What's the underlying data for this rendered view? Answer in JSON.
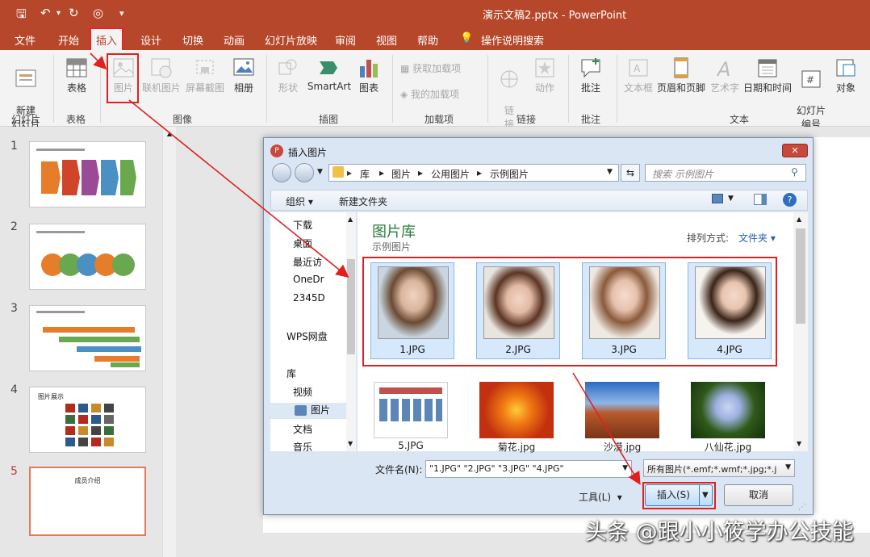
{
  "window": {
    "title": "演示文稿2.pptx - PowerPoint"
  },
  "menu_tabs": [
    "文件",
    "开始",
    "插入",
    "设计",
    "切换",
    "动画",
    "幻灯片放映",
    "审阅",
    "视图",
    "帮助"
  ],
  "tell_me": "操作说明搜索",
  "ribbon": {
    "new_slide": "新建\n幻灯片",
    "table": "表格",
    "picture": "图片",
    "online_picture": "联机图片",
    "screenshot": "屏幕截图",
    "album": "相册",
    "shapes": "形状",
    "smartart": "SmartArt",
    "chart": "图表",
    "get_addins": "获取加载项",
    "my_addins": "我的加载项",
    "link": "链\n接",
    "action": "动作",
    "comment": "批注",
    "textbox": "文本框",
    "header_footer": "页眉和页脚",
    "wordart": "艺术字",
    "datetime": "日期和时间",
    "slide_number": "幻灯片\n编号",
    "object": "对象",
    "groups": [
      "幻灯片",
      "表格",
      "图像",
      "插图",
      "加载项",
      "链接",
      "批注",
      "文本"
    ]
  },
  "slides": [
    {
      "num": "1"
    },
    {
      "num": "2"
    },
    {
      "num": "3"
    },
    {
      "num": "4",
      "caption": "图片展示"
    },
    {
      "num": "5",
      "caption": "成员介绍"
    }
  ],
  "dialog": {
    "title": "插入图片",
    "breadcrumb": [
      "库",
      "图片",
      "公用图片",
      "示例图片"
    ],
    "search_placeholder": "搜索 示例图片",
    "organize": "组织",
    "new_folder": "新建文件夹",
    "nav_items": [
      "下载",
      "桌面",
      "最近访",
      "OneDr",
      "2345D",
      "WPS网盘",
      "库",
      "视频",
      "图片",
      "文档",
      "音乐"
    ],
    "library_title": "图片库",
    "library_sub": "示例图片",
    "sort_label": "排列方式:",
    "sort_value": "文件夹",
    "files": [
      "1.JPG",
      "2.JPG",
      "3.JPG",
      "4.JPG",
      "5.JPG",
      "菊花.jpg",
      "沙漠.jpg",
      "八仙花.jpg"
    ],
    "filename_label": "文件名(N):",
    "filename_value": "\"1.JPG\" \"2.JPG\" \"3.JPG\" \"4.JPG\"",
    "filetype_value": "所有图片(*.emf;*.wmf;*.jpg;*.j",
    "tools": "工具(L)",
    "insert": "插入(S)",
    "cancel": "取消"
  },
  "watermark": "头条 @跟小小筱学办公技能",
  "colors": {
    "accent": "#b7472a",
    "highlight": "#e02020"
  }
}
